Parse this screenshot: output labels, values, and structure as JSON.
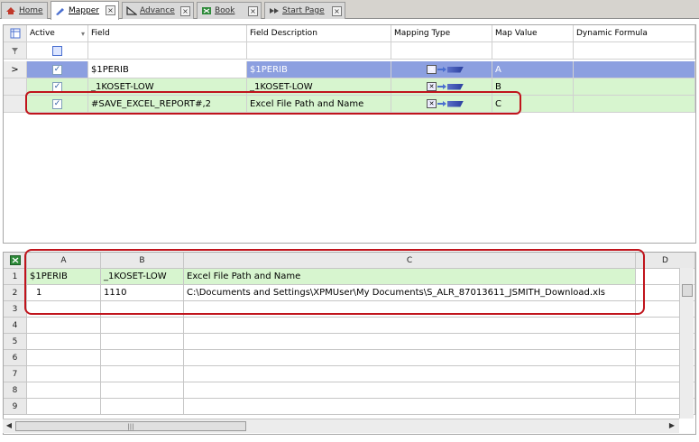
{
  "tabs": [
    {
      "label": "Home",
      "icon": "home-icon"
    },
    {
      "label": "Mapper",
      "icon": "mapper-icon"
    },
    {
      "label": "Advance",
      "icon": "advance-icon"
    },
    {
      "label": "Book",
      "icon": "book-icon"
    },
    {
      "label": "Start Page",
      "icon": "start-page-icon"
    }
  ],
  "close_glyph": "×",
  "mapper": {
    "columns": [
      "Active",
      "Field",
      "Field Description",
      "Mapping Type",
      "Map Value",
      "Dynamic Formula"
    ],
    "rows": [
      {
        "field": "$1PERIB",
        "description": "$1PERIB",
        "map_value": "A"
      },
      {
        "field": "_1KOSET-LOW",
        "description": "_1KOSET-LOW",
        "map_value": "B"
      },
      {
        "field": "#SAVE_EXCEL_REPORT#,2",
        "description": "Excel File Path and Name",
        "map_value": "C"
      }
    ],
    "current_row_glyph": ">"
  },
  "sheet": {
    "columns": [
      "A",
      "B",
      "C",
      "D"
    ],
    "row_numbers": [
      "1",
      "2",
      "3",
      "4",
      "5",
      "6",
      "7",
      "8",
      "9"
    ],
    "data": [
      [
        "$1PERIB",
        "_1KOSET-LOW",
        "Excel File Path and Name"
      ],
      [
        "1",
        "1110",
        "C:\\Documents and Settings\\XPMUser\\My Documents\\S_ALR_87013611_JSMITH_Download.xls"
      ]
    ]
  },
  "colors": {
    "selected_row": "#8c9fe0",
    "green_row": "#d7f5cf",
    "highlight": "#c0141c"
  }
}
